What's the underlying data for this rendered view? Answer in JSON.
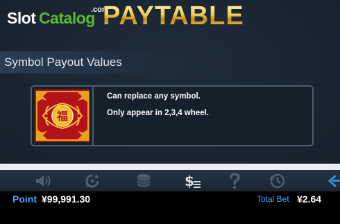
{
  "brand": {
    "slot": "Slot",
    "catalog": "Catalog",
    "com": ".com"
  },
  "title": "PAYTABLE",
  "section_header": "Symbol Payout Values",
  "symbol": {
    "icon": "fu-wild-symbol",
    "icon_glyph": "福",
    "line1": "Can replace any symbol.",
    "line2": "Only appear in 2,3,4 wheel."
  },
  "toolbar": {
    "icons": [
      "sound-icon",
      "autoplay-icon",
      "coins-icon",
      "paytable-icon",
      "help-icon",
      "history-icon",
      "back-icon"
    ],
    "paytable_glyph": "$"
  },
  "footer": {
    "point_label": "Point",
    "point_value": "¥99,991.30",
    "bet_label": "Total Bet",
    "bet_value": "¥2.64"
  },
  "colors": {
    "accent_blue": "#4aa3ff",
    "gold": "#f3c94e",
    "brand_green": "#5cb832"
  }
}
